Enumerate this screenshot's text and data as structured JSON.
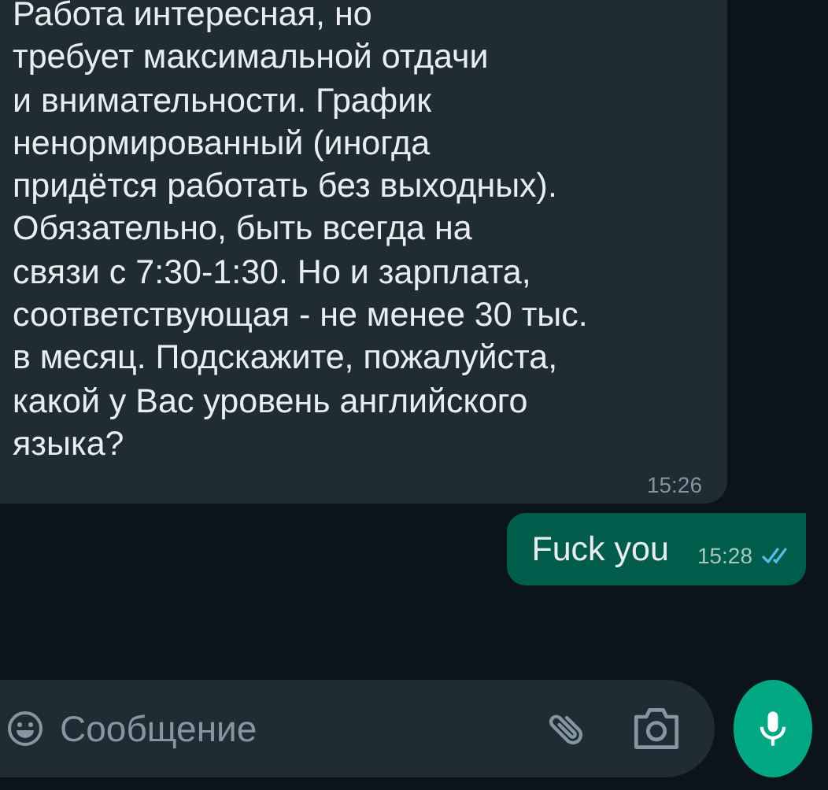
{
  "messages": [
    {
      "outgoing": false,
      "text": "Работа интересная, но\nтребует максимальной отдачи\nи внимательности. График\nненормированный (иногда\nпридётся работать без выходных).\nОбязательно, быть всегда на\nсвязи с 7:30-1:30. Но и зарплата,\nсоответствующая - не менее 30 тыс.\nв месяц. Подскажите, пожалуйста,\nкакой у Вас уровень английского\nязыка?",
      "time": "15:26"
    },
    {
      "outgoing": true,
      "text": "Fuck you",
      "time": "15:28",
      "read": true
    }
  ],
  "composer": {
    "placeholder": "Сообщение"
  }
}
